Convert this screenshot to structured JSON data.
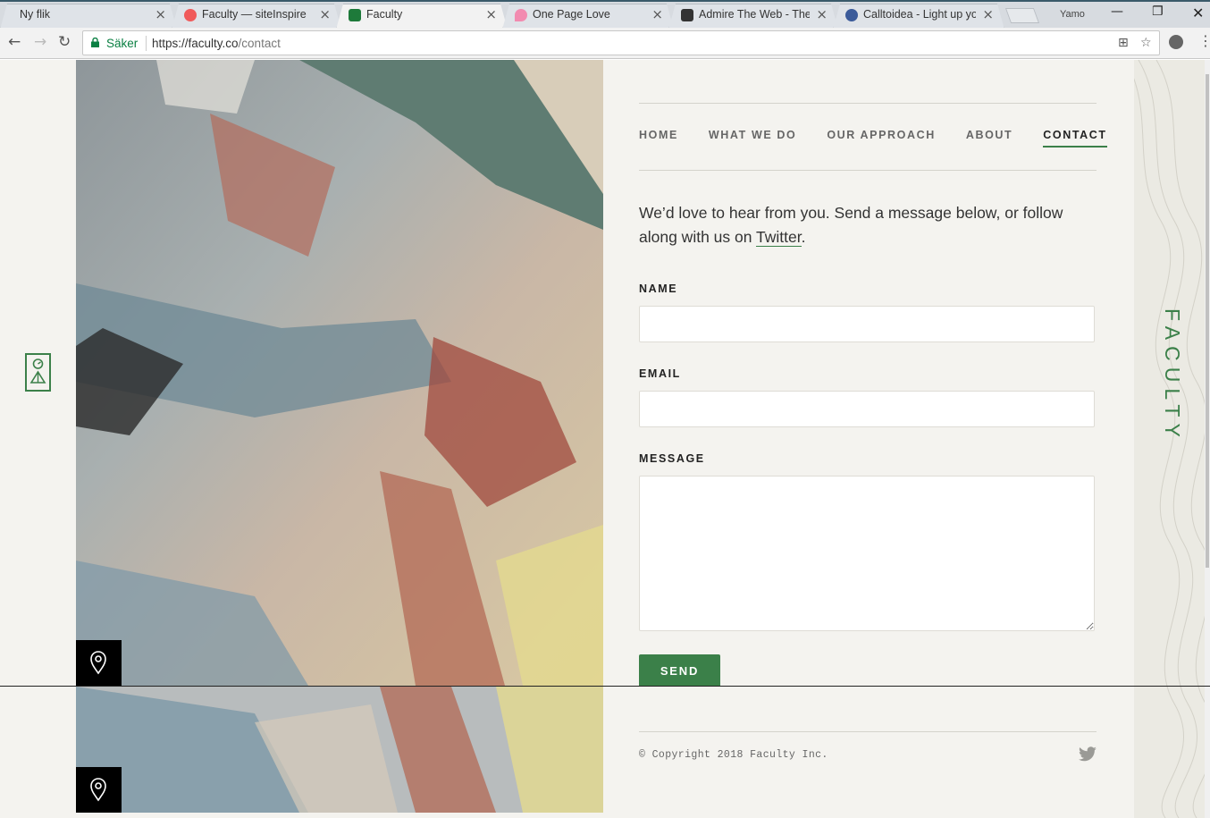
{
  "browser": {
    "tabs": [
      {
        "label": "Ny flik",
        "active": false,
        "favicon_color": ""
      },
      {
        "label": "Faculty — siteInspire",
        "active": false,
        "favicon_color": "#f05a5a"
      },
      {
        "label": "Faculty",
        "active": true,
        "favicon_color": "#1e7a3a"
      },
      {
        "label": "One Page Love",
        "active": false,
        "favicon_color": "#f28bb0"
      },
      {
        "label": "Admire The Web - The",
        "active": false,
        "favicon_color": "#333333"
      },
      {
        "label": "Calltoidea - Light up yo",
        "active": false,
        "favicon_color": "#3b5b9a"
      }
    ],
    "profile_name": "Yamo",
    "secure_label": "Säker",
    "url_host": "https://faculty.co",
    "url_path": "/contact"
  },
  "site": {
    "brand": "FACULTY",
    "accent_color": "#3b8049",
    "nav": [
      {
        "label": "HOME",
        "active": false
      },
      {
        "label": "WHAT WE DO",
        "active": false
      },
      {
        "label": "OUR APPROACH",
        "active": false
      },
      {
        "label": "ABOUT",
        "active": false
      },
      {
        "label": "CONTACT",
        "active": true
      }
    ],
    "intro": {
      "text": "We’d love to hear from you. Send a message below, or follow along with us on ",
      "link": "Twitter",
      "suffix": "."
    },
    "form": {
      "name_label": "NAME",
      "email_label": "EMAIL",
      "message_label": "MESSAGE",
      "name_value": "",
      "email_value": "",
      "message_value": "",
      "send_label": "SEND"
    },
    "footer": {
      "copyright": "© Copyright 2018 Faculty Inc."
    },
    "icons": [
      "location-pin-icon",
      "twitter-icon",
      "faculty-logo-icon"
    ]
  }
}
